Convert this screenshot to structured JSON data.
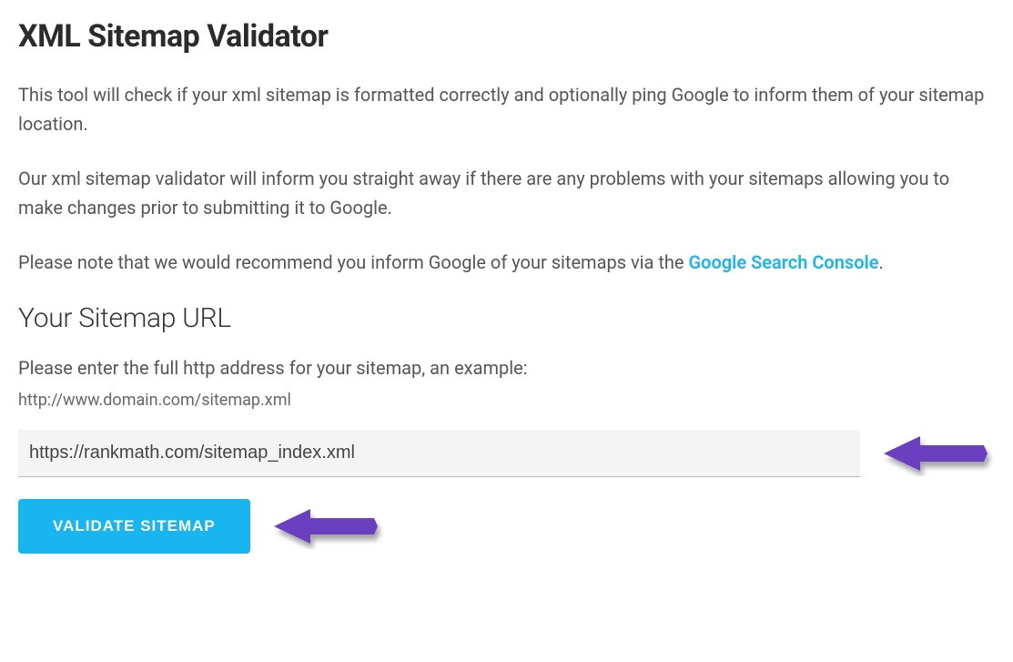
{
  "title": "XML Sitemap Validator",
  "para1": "This tool will check if your xml sitemap is formatted correctly and optionally ping Google to inform them of your sitemap location.",
  "para2": "Our xml sitemap validator will inform you straight away if there are any problems with your sitemaps allowing you to make changes prior to submitting it to Google.",
  "para3_prefix": "Please note that we would recommend you inform Google of your sitemaps via the ",
  "para3_link": "Google Search Console",
  "para3_suffix": ".",
  "section_title": "Your Sitemap URL",
  "hint": "Please enter the full http address for your sitemap, an example:",
  "example": "http://www.domain.com/sitemap.xml",
  "input_value": "https://rankmath.com/sitemap_index.xml",
  "button_label": "VALIDATE SITEMAP",
  "colors": {
    "accent": "#18b5f0",
    "arrow": "#6a3fc0"
  }
}
